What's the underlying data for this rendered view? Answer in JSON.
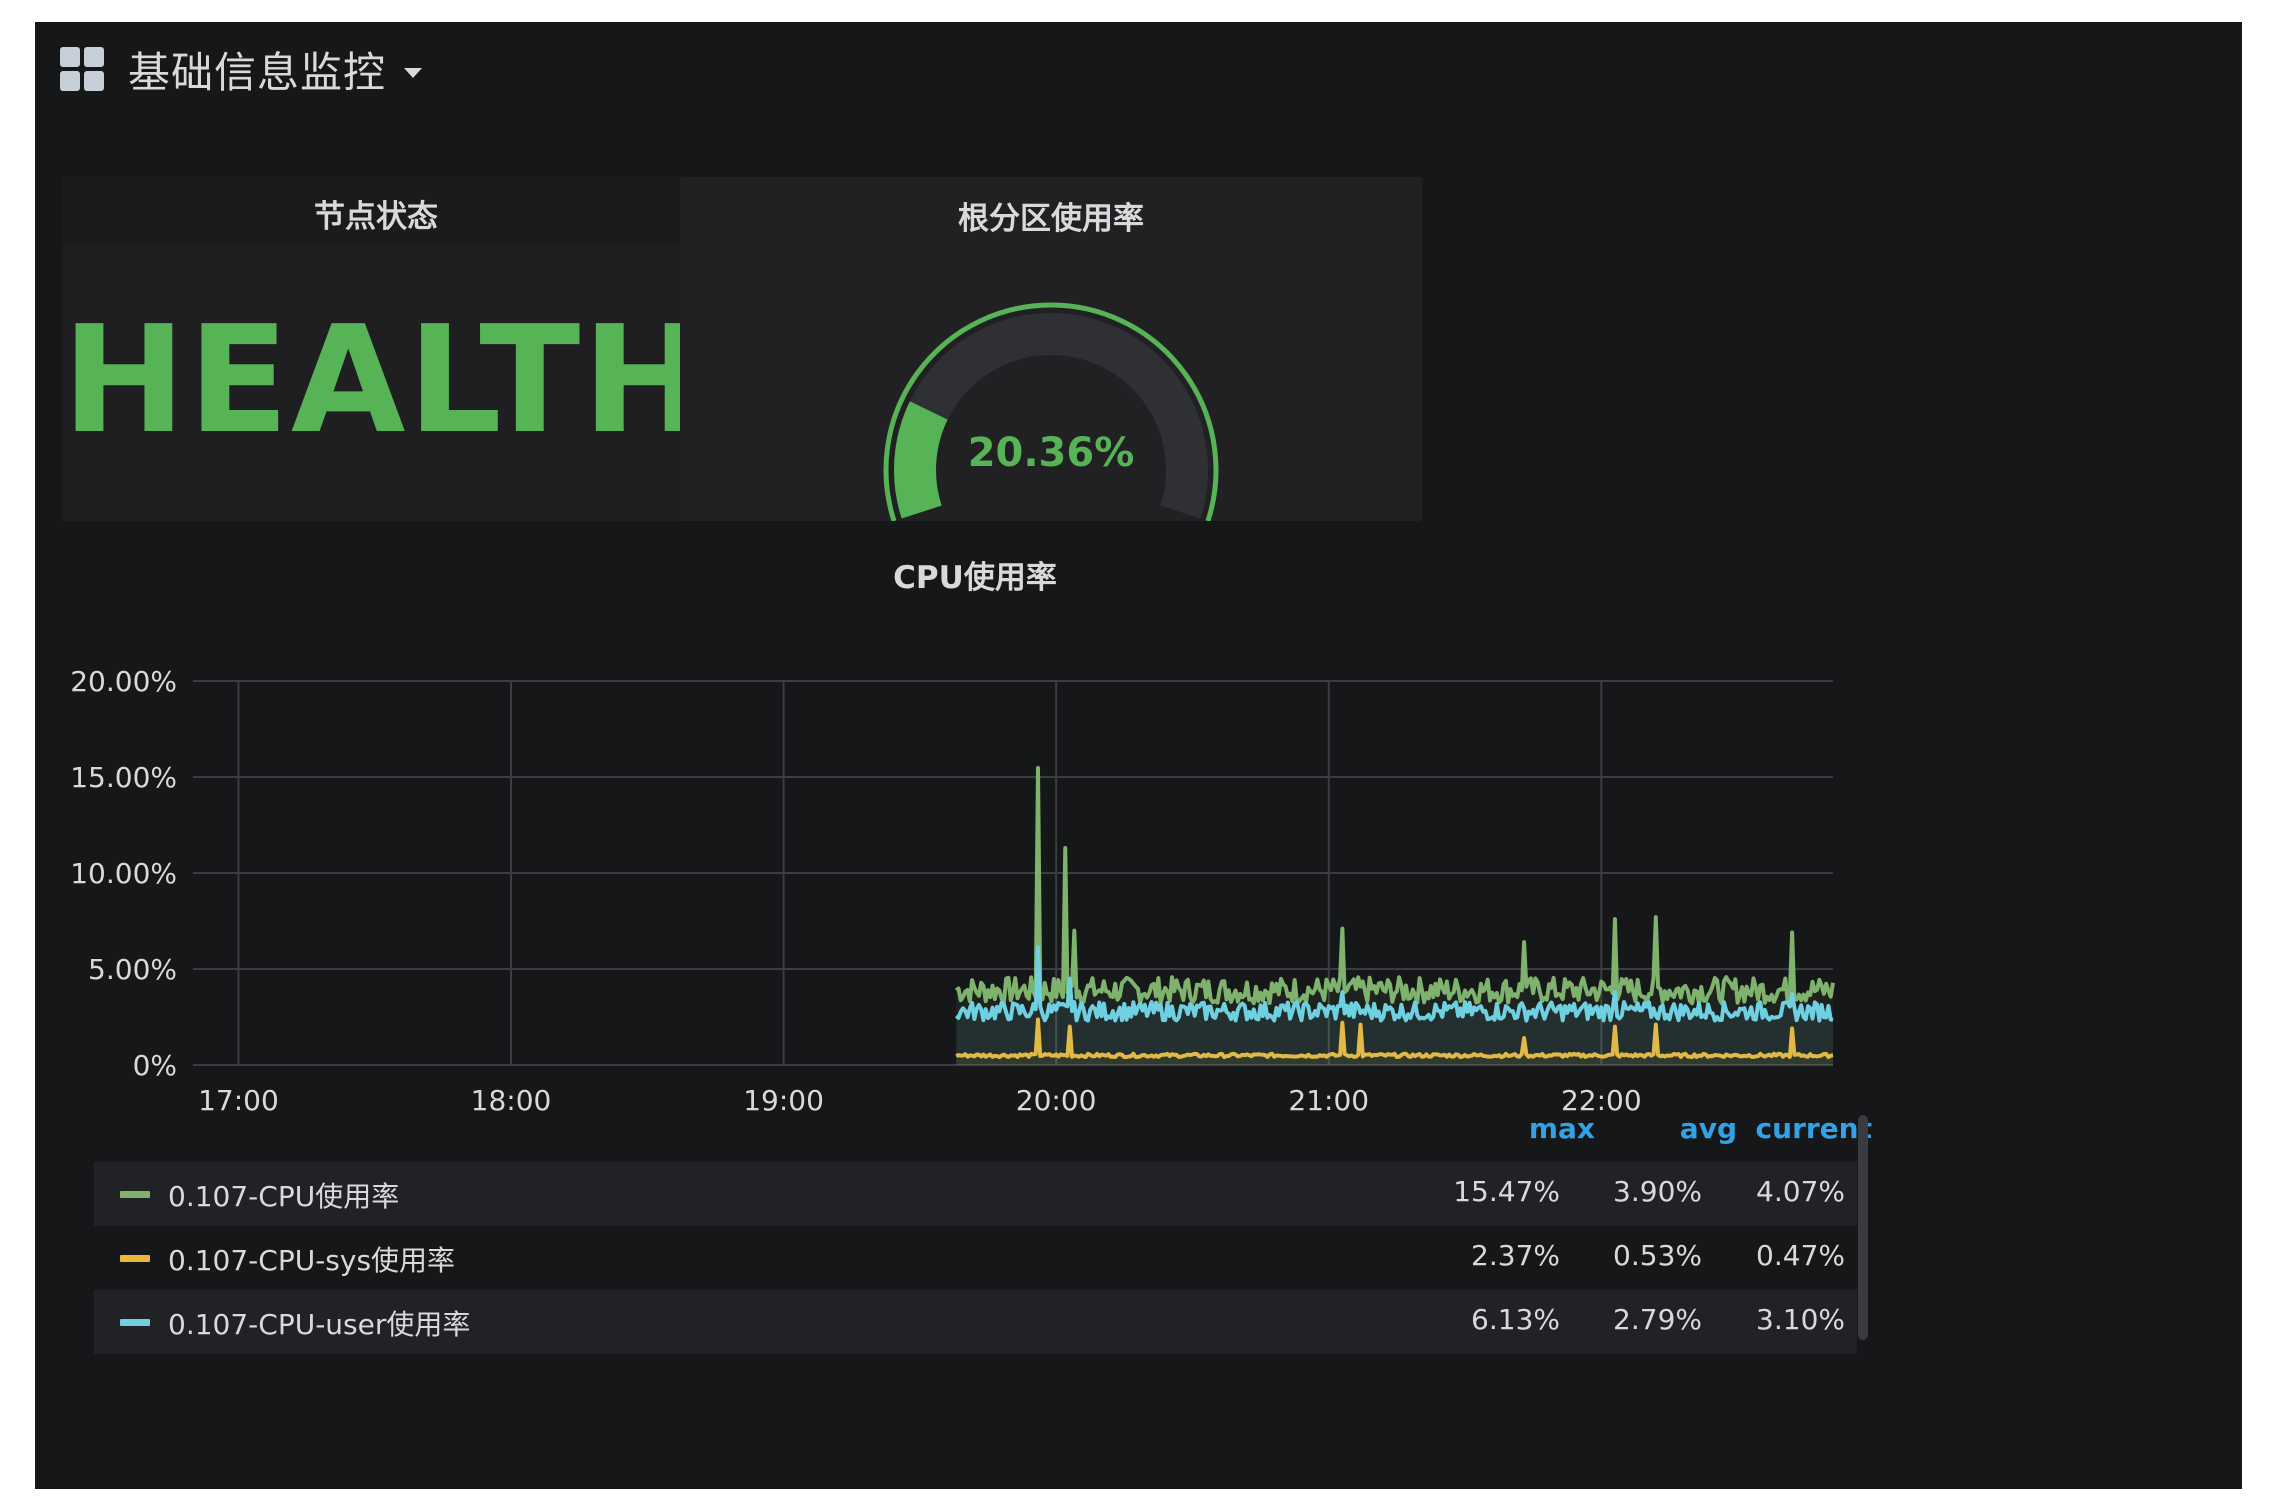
{
  "dashboard": {
    "title": "基础信息监控"
  },
  "panels": {
    "node_status": {
      "title": "节点状态",
      "value": "HEALTH",
      "color": "#56b356"
    },
    "root_partition": {
      "title": "根分区使用率",
      "value_text": "20.36%",
      "value": 20.36,
      "color": "#56b356"
    },
    "cpu": {
      "title": "CPU使用率"
    }
  },
  "chart_data": {
    "type": "line",
    "title": "CPU使用率",
    "x_ticks": [
      "17:00",
      "18:00",
      "19:00",
      "20:00",
      "21:00",
      "22:00"
    ],
    "y_ticks": [
      "20.00%",
      "15.00%",
      "10.00%",
      "5.00%",
      "0%"
    ],
    "ylim": [
      0,
      20
    ],
    "xlim": [
      "16:50",
      "22:51"
    ],
    "grid": true,
    "x_start": "19:38",
    "series": [
      {
        "name": "0.107-CPU使用率",
        "color": "#7eb26d",
        "base": 3.9,
        "spikes": [
          [
            "19:56",
            15.47
          ],
          [
            "20:02",
            11.3
          ],
          [
            "20:04",
            7.0
          ],
          [
            "21:03",
            7.1
          ],
          [
            "21:43",
            6.4
          ],
          [
            "22:03",
            7.6
          ],
          [
            "22:12",
            7.7
          ],
          [
            "22:42",
            6.9
          ]
        ]
      },
      {
        "name": "0.107-CPU-sys使用率",
        "color": "#eab839",
        "base": 0.5,
        "spikes": [
          [
            "19:56",
            2.37
          ],
          [
            "20:03",
            2.0
          ],
          [
            "21:03",
            2.2
          ],
          [
            "21:07",
            2.1
          ],
          [
            "21:43",
            1.4
          ],
          [
            "22:03",
            2.0
          ],
          [
            "22:12",
            2.1
          ],
          [
            "22:42",
            1.9
          ]
        ]
      },
      {
        "name": "0.107-CPU-user使用率",
        "color": "#6ed0e0",
        "base": 2.8,
        "spikes": [
          [
            "19:56",
            6.13
          ],
          [
            "20:03",
            4.5
          ],
          [
            "21:03",
            3.8
          ],
          [
            "22:03",
            3.8
          ],
          [
            "22:42",
            3.7
          ]
        ]
      }
    ]
  },
  "legend": {
    "headers": {
      "max": "max",
      "avg": "avg",
      "current": "current"
    },
    "rows": [
      {
        "name": "0.107-CPU使用率",
        "color": "#7eb26d",
        "max": "15.47%",
        "avg": "3.90%",
        "current": "4.07%"
      },
      {
        "name": "0.107-CPU-sys使用率",
        "color": "#eab839",
        "max": "2.37%",
        "avg": "0.53%",
        "current": "0.47%"
      },
      {
        "name": "0.107-CPU-user使用率",
        "color": "#6ed0e0",
        "max": "6.13%",
        "avg": "2.79%",
        "current": "3.10%"
      }
    ]
  }
}
